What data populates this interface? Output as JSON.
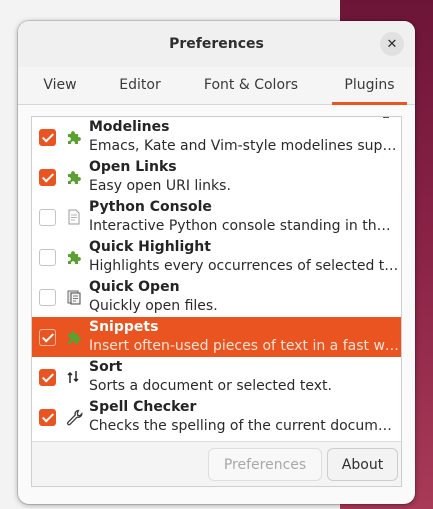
{
  "window": {
    "title": "Preferences",
    "close_glyph": "✕"
  },
  "tabs": [
    {
      "label": "View"
    },
    {
      "label": "Editor"
    },
    {
      "label": "Font & Colors"
    },
    {
      "label": "Plugins",
      "active": true
    }
  ],
  "plugins": [
    {
      "name": "Modelines",
      "desc": "Emacs, Kate and Vim-style modelines support for gedit.",
      "enabled": true,
      "icon": "puzzle-icon"
    },
    {
      "name": "Open Links",
      "desc": "Easy open URI links.",
      "enabled": true,
      "icon": "puzzle-icon"
    },
    {
      "name": "Python Console",
      "desc": "Interactive Python console standing in the bottom panel.",
      "enabled": false,
      "icon": "document-icon"
    },
    {
      "name": "Quick Highlight",
      "desc": "Highlights every occurrences of selected text.",
      "enabled": false,
      "icon": "puzzle-icon"
    },
    {
      "name": "Quick Open",
      "desc": "Quickly open files.",
      "enabled": false,
      "icon": "files-icon"
    },
    {
      "name": "Snippets",
      "desc": "Insert often-used pieces of text in a fast way.",
      "enabled": true,
      "icon": "puzzle-icon",
      "selected": true
    },
    {
      "name": "Sort",
      "desc": "Sorts a document or selected text.",
      "enabled": true,
      "icon": "sort-icon"
    },
    {
      "name": "Spell Checker",
      "desc": "Checks the spelling of the current document.",
      "enabled": true,
      "icon": "wrench-icon"
    }
  ],
  "buttons": {
    "preferences_label": "Preferences",
    "about_label": "About"
  },
  "colors": {
    "accent": "#e95420",
    "plugin_green": "#5aa132"
  }
}
